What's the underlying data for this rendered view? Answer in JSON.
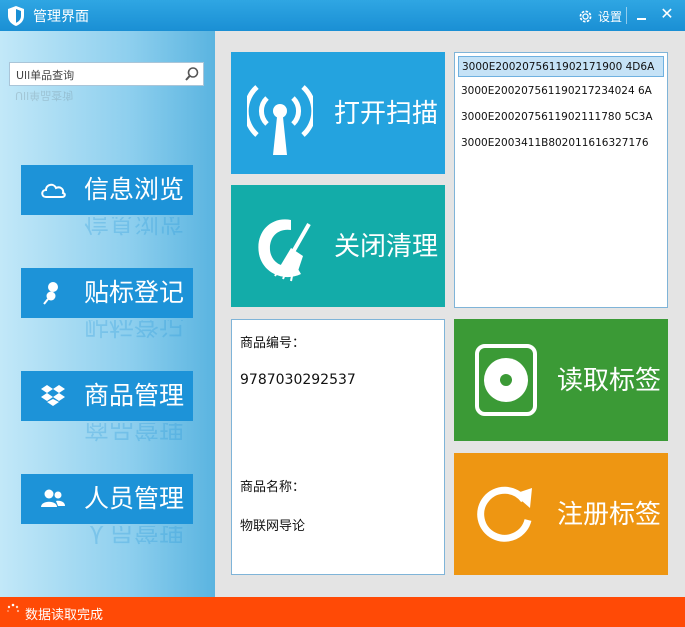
{
  "window": {
    "title": "管理界面",
    "settings_label": "设置",
    "minimize_glyph": "_",
    "close_glyph": "✕"
  },
  "search": {
    "placeholder": "Ull单品查询"
  },
  "sidebar": {
    "items": [
      {
        "label": "信息浏览",
        "icon": "cloud-icon"
      },
      {
        "label": "贴标登记",
        "icon": "pin-icon"
      },
      {
        "label": "商品管理",
        "icon": "dropbox-icon"
      },
      {
        "label": "人员管理",
        "icon": "users-icon"
      }
    ]
  },
  "tiles": {
    "scan": {
      "label": "打开扫描",
      "icon": "signal-tower-icon"
    },
    "clean": {
      "label": "关闭清理",
      "icon": "broom-icon"
    },
    "read": {
      "label": "读取标签",
      "icon": "disc-icon"
    },
    "register": {
      "label": "注册标签",
      "icon": "refresh-icon"
    }
  },
  "tag_list": {
    "items": [
      "3000E2002075611902171900 4D6A",
      "3000E200207561190217234024 6A",
      "3000E2002075611902111780 5C3A",
      "3000E2003411B802011616327176"
    ],
    "selected_index": 0
  },
  "product": {
    "code_label": "商品编号：",
    "code_value": "9787030292537",
    "name_label": "商品名称：",
    "name_value": "物联网导论"
  },
  "status": {
    "text": "数据读取完成"
  },
  "colors": {
    "accent": "#1d93d8",
    "scan": "#24a3df",
    "clean": "#13aca9",
    "read": "#3b9a36",
    "register": "#ee9612",
    "status": "#ff4a06"
  }
}
